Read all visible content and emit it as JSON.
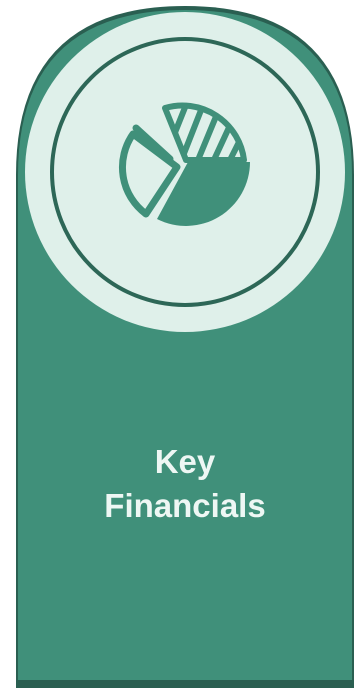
{
  "card": {
    "title_line1": "Key",
    "title_line2": "Financials",
    "icon": "pie-chart-icon",
    "colors": {
      "panel": "#40907a",
      "panel_dark": "#2e6f5d",
      "medallion": "#dff0ea",
      "ring": "#2d6757",
      "icon_fill": "#40907a"
    }
  }
}
